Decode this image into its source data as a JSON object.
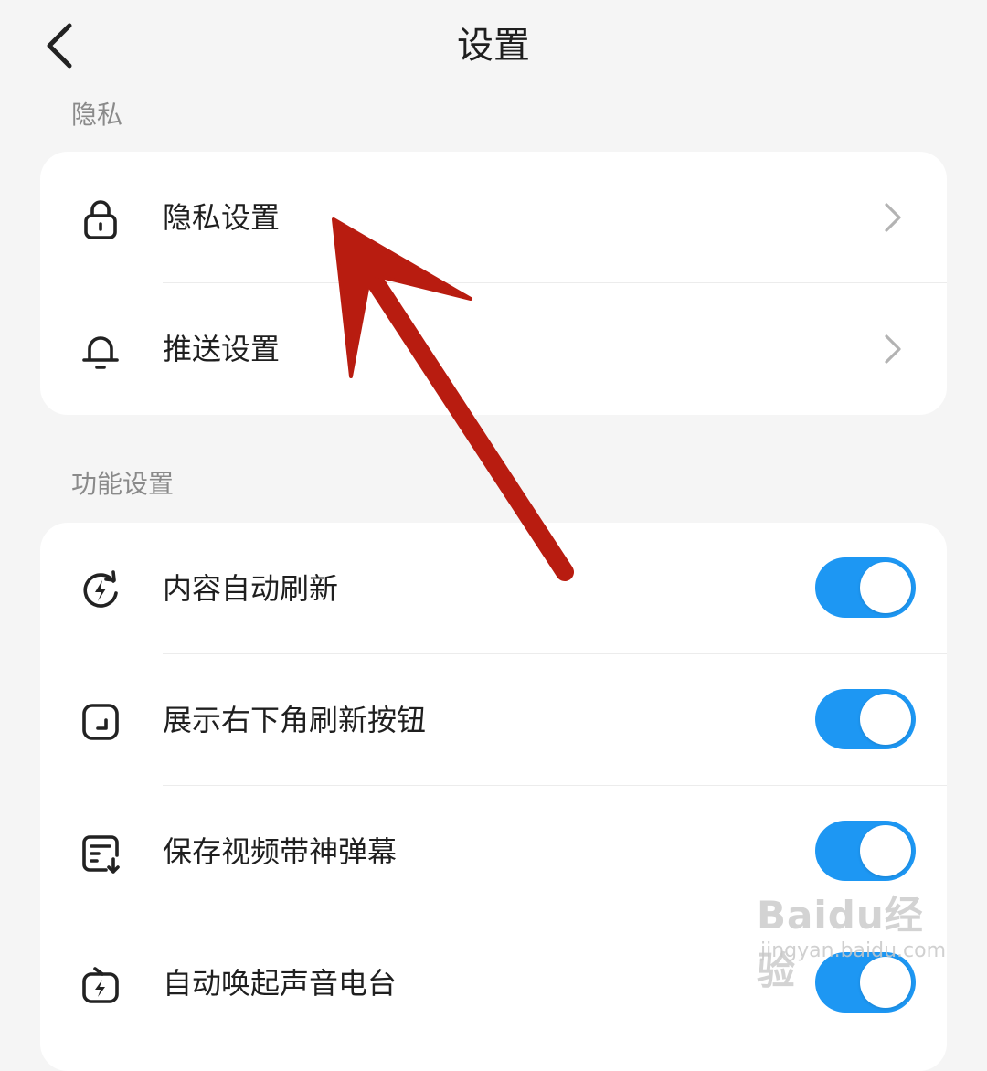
{
  "header": {
    "title": "设置"
  },
  "sections": [
    {
      "label": "隐私",
      "items": [
        {
          "label": "隐私设置",
          "icon": "lock-icon",
          "control": "chevron"
        },
        {
          "label": "推送设置",
          "icon": "bell-icon",
          "control": "chevron"
        }
      ]
    },
    {
      "label": "功能设置",
      "items": [
        {
          "label": "内容自动刷新",
          "icon": "auto-refresh-icon",
          "control": "toggle",
          "on": true
        },
        {
          "label": "展示右下角刷新按钮",
          "icon": "corner-button-icon",
          "control": "toggle",
          "on": true
        },
        {
          "label": "保存视频带神弹幕",
          "icon": "danmaku-save-icon",
          "control": "toggle",
          "on": true
        },
        {
          "label": "自动唤起声音电台",
          "icon": "radio-icon",
          "control": "toggle",
          "on": true
        }
      ]
    }
  ],
  "watermark": {
    "brand": "Baidu经验",
    "url": "jingyan.baidu.com"
  },
  "colors": {
    "toggle_on": "#1d97f3",
    "background": "#f5f5f5",
    "arrow": "#b81c10"
  }
}
